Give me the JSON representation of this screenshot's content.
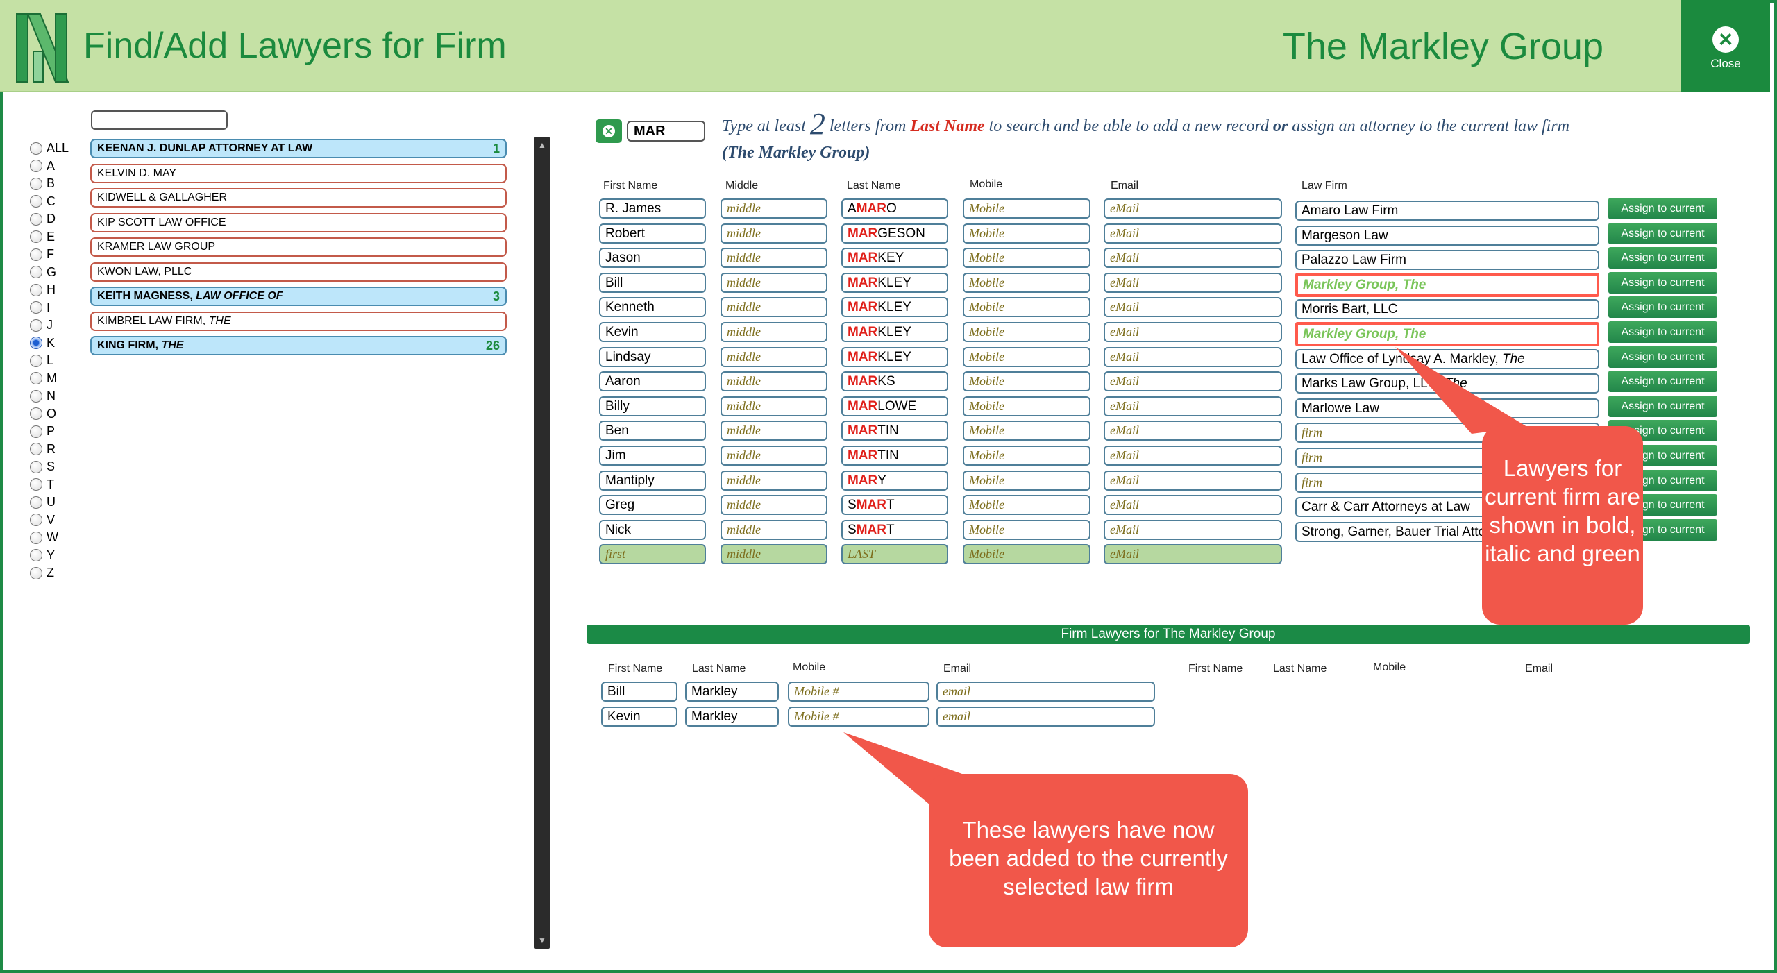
{
  "header": {
    "title": "Find/Add Lawyers for Firm",
    "current_firm": "The Markley Group",
    "close_label": "Close"
  },
  "alphabet": [
    "ALL",
    "A",
    "B",
    "C",
    "D",
    "E",
    "F",
    "G",
    "H",
    "I",
    "J",
    "K",
    "L",
    "M",
    "N",
    "O",
    "P",
    "R",
    "S",
    "T",
    "U",
    "V",
    "W",
    "Y",
    "Z"
  ],
  "alphabet_selected": "K",
  "firms": [
    {
      "name": "KEENAN J. DUNLAP ATTORNEY AT LAW",
      "suffix": "",
      "count": "1",
      "highlight": true
    },
    {
      "name": "KELVIN D. MAY",
      "suffix": "",
      "count": "",
      "highlight": false
    },
    {
      "name": "KIDWELL & GALLAGHER",
      "suffix": "",
      "count": "",
      "highlight": false
    },
    {
      "name": "KIP SCOTT LAW OFFICE",
      "suffix": "",
      "count": "",
      "highlight": false
    },
    {
      "name": "KRAMER LAW GROUP",
      "suffix": "",
      "count": "",
      "highlight": false
    },
    {
      "name": "KWON LAW, PLLC",
      "suffix": "",
      "count": "",
      "highlight": false
    },
    {
      "name": "KEITH MAGNESS, ",
      "suffix": "LAW OFFICE OF",
      "count": "3",
      "highlight": true
    },
    {
      "name": "KIMBREL LAW FIRM, ",
      "suffix": "THE",
      "count": "",
      "highlight": false
    },
    {
      "name": "KING FIRM, ",
      "suffix": "THE",
      "count": "26",
      "highlight": true
    }
  ],
  "search": {
    "value": "MAR",
    "hint_pre": "Type at least ",
    "hint_num": "2",
    "hint_mid": " letters from ",
    "hint_field": "Last Name",
    "hint_post1": " to search and be able to add a new record ",
    "hint_or": "or",
    "hint_post2": " assign an attorney to the current law firm",
    "hint_firm": "(The Markley Group)"
  },
  "columns": {
    "first": "First Name",
    "middle": "Middle",
    "last": "Last Name",
    "mobile": "Mobile",
    "email": "Email",
    "firm": "Law Firm"
  },
  "placeholders": {
    "middle": "middle",
    "mobile": "Mobile",
    "email": "eMail",
    "firm": "firm"
  },
  "results": [
    {
      "first": "R. James",
      "last_pre": "A",
      "last_hit": "MAR",
      "last_post": "O",
      "firm": "Amaro Law Firm",
      "firm_suffix": "",
      "current": false
    },
    {
      "first": "Robert",
      "last_pre": "",
      "last_hit": "MAR",
      "last_post": "GESON",
      "firm": "Margeson Law",
      "firm_suffix": "",
      "current": false
    },
    {
      "first": "Jason",
      "last_pre": "",
      "last_hit": "MAR",
      "last_post": "KEY",
      "firm": "Palazzo Law Firm",
      "firm_suffix": "",
      "current": false
    },
    {
      "first": "Bill",
      "last_pre": "",
      "last_hit": "MAR",
      "last_post": "KLEY",
      "firm": "Markley Group, The",
      "firm_suffix": "",
      "current": true
    },
    {
      "first": "Kenneth",
      "last_pre": "",
      "last_hit": "MAR",
      "last_post": "KLEY",
      "firm": "Morris Bart, LLC",
      "firm_suffix": "",
      "current": false
    },
    {
      "first": "Kevin",
      "last_pre": "",
      "last_hit": "MAR",
      "last_post": "KLEY",
      "firm": "Markley Group, The",
      "firm_suffix": "",
      "current": true
    },
    {
      "first": "Lindsay",
      "last_pre": "",
      "last_hit": "MAR",
      "last_post": "KLEY",
      "firm": "Law Office of Lyndsay A. Markley, ",
      "firm_suffix": "The",
      "current": false
    },
    {
      "first": "Aaron",
      "last_pre": "",
      "last_hit": "MAR",
      "last_post": "KS",
      "firm": "Marks Law Group, LLC, ",
      "firm_suffix": "The",
      "current": false
    },
    {
      "first": "Billy",
      "last_pre": "",
      "last_hit": "MAR",
      "last_post": "LOWE",
      "firm": "Marlowe Law",
      "firm_suffix": "",
      "current": false
    },
    {
      "first": "Ben",
      "last_pre": "",
      "last_hit": "MAR",
      "last_post": "TIN",
      "firm": "",
      "firm_suffix": "",
      "current": false
    },
    {
      "first": "Jim",
      "last_pre": "",
      "last_hit": "MAR",
      "last_post": "TIN",
      "firm": "",
      "firm_suffix": "",
      "current": false
    },
    {
      "first": "Mantiply",
      "last_pre": "",
      "last_hit": "MAR",
      "last_post": "Y",
      "firm": "",
      "firm_suffix": "",
      "current": false
    },
    {
      "first": "Greg",
      "last_pre": "S",
      "last_hit": "MAR",
      "last_post": "T",
      "firm": "Carr & Carr Attorneys at Law",
      "firm_suffix": "",
      "current": false
    },
    {
      "first": "Nick",
      "last_pre": "S",
      "last_hit": "MAR",
      "last_post": "T",
      "firm": "Strong, Garner, Bauer Trial Attorneys",
      "firm_suffix": "",
      "current": false
    }
  ],
  "new_row": {
    "first": "first",
    "middle": "middle",
    "last": "LAST",
    "mobile": "Mobile",
    "email": "eMail"
  },
  "assign_label": "Assign to current",
  "firm_lawyers": {
    "title": "Firm Lawyers for The Markley Group",
    "cols": {
      "first": "First Name",
      "last": "Last Name",
      "mobile": "Mobile",
      "email": "Email"
    },
    "placeholders": {
      "mobile": "Mobile #",
      "email": "email"
    },
    "rows": [
      {
        "first": "Bill",
        "last": "Markley"
      },
      {
        "first": "Kevin",
        "last": "Markley"
      }
    ]
  },
  "callouts": {
    "top": "Lawyers for current firm are shown in bold, italic and green",
    "bottom": "These lawyers have now been added to the currently selected law firm"
  },
  "colors": {
    "brand_green": "#1b8a3e",
    "header_bg": "#c5e1a5",
    "highlight_red": "#e0201a",
    "callout": "#f1574a",
    "firm_highlight_bg": "#bde6fa"
  }
}
